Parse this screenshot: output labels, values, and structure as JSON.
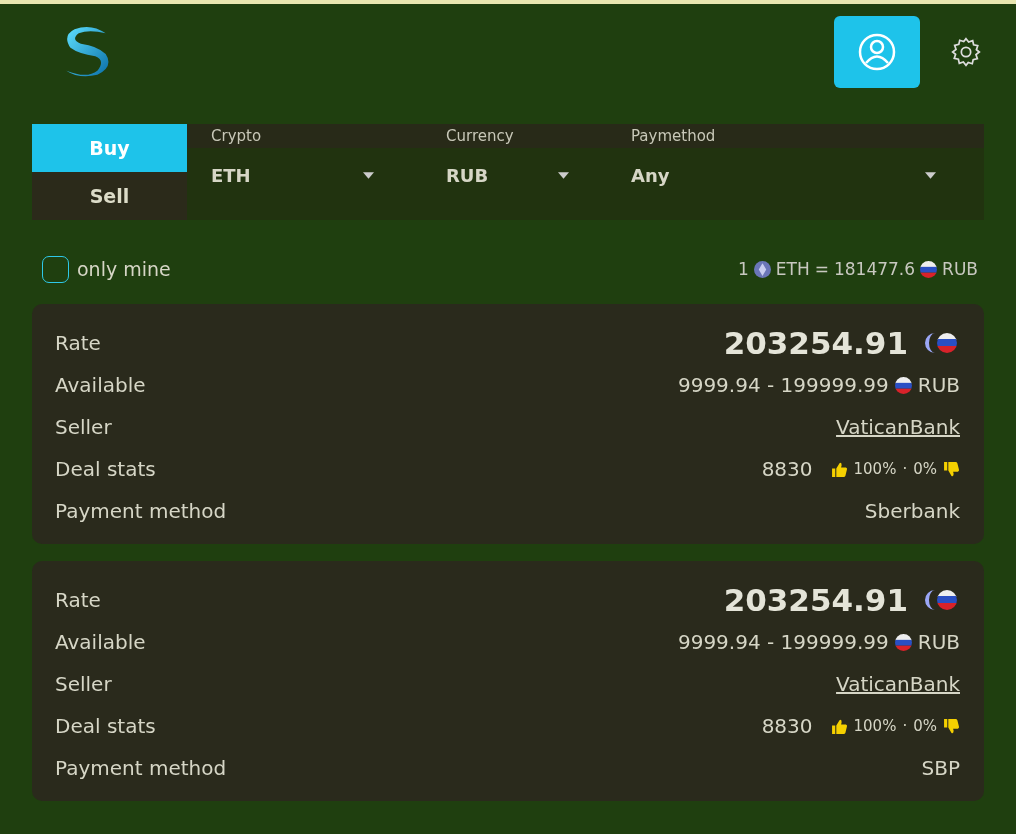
{
  "header": {
    "profile_selected": true
  },
  "tabs": [
    {
      "label": "Buy",
      "selected": true
    },
    {
      "label": "Sell",
      "selected": false
    }
  ],
  "filters": [
    {
      "label": "Crypto",
      "value": "ETH"
    },
    {
      "label": "Currency",
      "value": "RUB"
    },
    {
      "label": "Paymethod",
      "value": "Any"
    }
  ],
  "only_mine": {
    "label": "only mine",
    "checked": false
  },
  "exchange_rate": {
    "amount": "1",
    "crypto": "ETH",
    "equals": "=",
    "value": "181477.6",
    "currency": "RUB"
  },
  "offers": [
    {
      "fields": [
        {
          "label": "Rate",
          "kind": "rate",
          "value": "203254.91"
        },
        {
          "label": "Available",
          "kind": "amount",
          "value": "9999.94 - 199999.99",
          "currency": "RUB"
        },
        {
          "label": "Seller",
          "kind": "link",
          "value": "VaticanBank"
        },
        {
          "label": "Deal stats",
          "kind": "stats",
          "count": "8830",
          "positive": "100%",
          "separator": "·",
          "negative": "0%"
        },
        {
          "label": "Payment method",
          "kind": "text",
          "value": "Sberbank"
        }
      ]
    },
    {
      "fields": [
        {
          "label": "Rate",
          "kind": "rate",
          "value": "203254.91"
        },
        {
          "label": "Available",
          "kind": "amount",
          "value": "9999.94 - 199999.99",
          "currency": "RUB"
        },
        {
          "label": "Seller",
          "kind": "link",
          "value": "VaticanBank"
        },
        {
          "label": "Deal stats",
          "kind": "stats",
          "count": "8830",
          "positive": "100%",
          "separator": "·",
          "negative": "0%"
        },
        {
          "label": "Payment method",
          "kind": "text",
          "value": "SBP"
        }
      ]
    }
  ]
}
